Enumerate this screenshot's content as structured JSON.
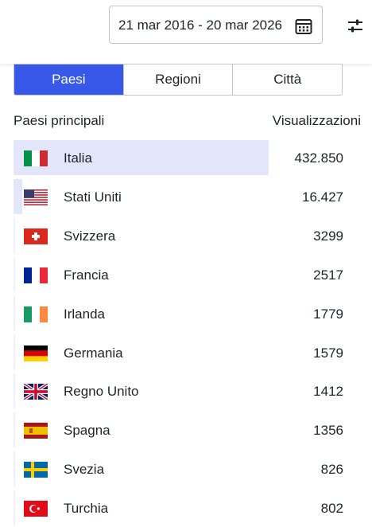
{
  "header": {
    "date_range": "21 mar 2016 - 20 mar 2026",
    "calendar_icon": "calendar-icon",
    "filter_icon": "sliders-icon"
  },
  "tabs": [
    {
      "label": "Paesi",
      "active": true
    },
    {
      "label": "Regioni",
      "active": false
    },
    {
      "label": "Città",
      "active": false
    }
  ],
  "table": {
    "header_left": "Paesi principali",
    "header_right": "Visualizzazioni",
    "rows": [
      {
        "country": "Italia",
        "value": "432.850",
        "flag": "it",
        "share": 1.0
      },
      {
        "country": "Stati Uniti",
        "value": "16.427",
        "flag": "us",
        "share": 0.038
      },
      {
        "country": "Svizzera",
        "value": "3299",
        "flag": "ch",
        "share": 0.0076
      },
      {
        "country": "Francia",
        "value": "2517",
        "flag": "fr",
        "share": 0.0058
      },
      {
        "country": "Irlanda",
        "value": "1779",
        "flag": "ie",
        "share": 0.0041
      },
      {
        "country": "Germania",
        "value": "1579",
        "flag": "de",
        "share": 0.0036
      },
      {
        "country": "Regno Unito",
        "value": "1412",
        "flag": "gb",
        "share": 0.0033
      },
      {
        "country": "Spagna",
        "value": "1356",
        "flag": "es",
        "share": 0.0031
      },
      {
        "country": "Svezia",
        "value": "826",
        "flag": "se",
        "share": 0.0019
      },
      {
        "country": "Turchia",
        "value": "802",
        "flag": "tr",
        "share": 0.0019
      }
    ]
  },
  "colors": {
    "accent": "#3858e9",
    "bar": "#e3e6fb"
  }
}
